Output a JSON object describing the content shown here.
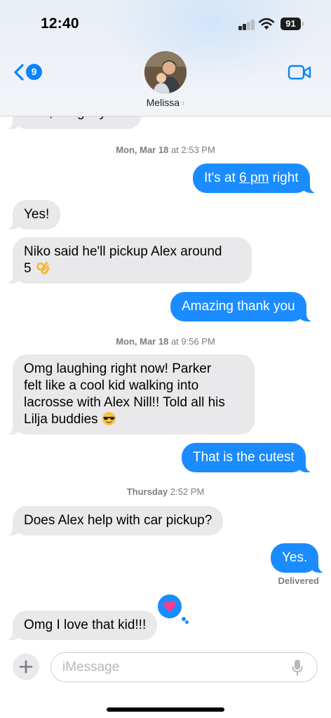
{
  "status_bar": {
    "time": "12:40",
    "battery": "91"
  },
  "header": {
    "back_badge": "9",
    "contact_name": "Melissa",
    "contact_chevron": "›"
  },
  "thread": {
    "partial_message": "Ohh, we got you!!",
    "timestamps": [
      {
        "day": "Mon, Mar 18",
        "time": "at 2:53 PM"
      },
      {
        "day": "Mon, Mar 18",
        "time": "at 9:56 PM"
      },
      {
        "day": "Thursday",
        "time": "2:52 PM"
      }
    ],
    "messages": [
      {
        "from": "me",
        "parts": [
          "It's at ",
          "6 pm",
          " right"
        ]
      },
      {
        "from": "them",
        "text": "Yes!"
      },
      {
        "from": "them",
        "line1": "Niko said he'll pickup Alex around",
        "line2": "5",
        "emoji": "ok-hand-emoji"
      },
      {
        "from": "me",
        "text": "Amazing thank you"
      },
      {
        "from": "them",
        "line1": "Omg laughing right now! Parker",
        "line2": "felt like a cool kid walking into",
        "line3": "lacrosse with Alex Nill!! Told all his",
        "line4": "Lilja buddies",
        "emoji": "sunglasses-emoji"
      },
      {
        "from": "me",
        "text": "That is the cutest"
      },
      {
        "from": "them",
        "text": "Does Alex help with car pickup?"
      },
      {
        "from": "me",
        "text": "Yes."
      },
      {
        "from": "them",
        "text": "Omg I love that kid!!!",
        "tapback": "heart-icon"
      }
    ],
    "delivered": "Delivered"
  },
  "composer": {
    "placeholder": "iMessage"
  },
  "colors": {
    "outgoing": "#1a8cff",
    "incoming": "#e9e9eb",
    "accent": "#0a84ff",
    "tapback_heart": "#ff3b8f"
  }
}
